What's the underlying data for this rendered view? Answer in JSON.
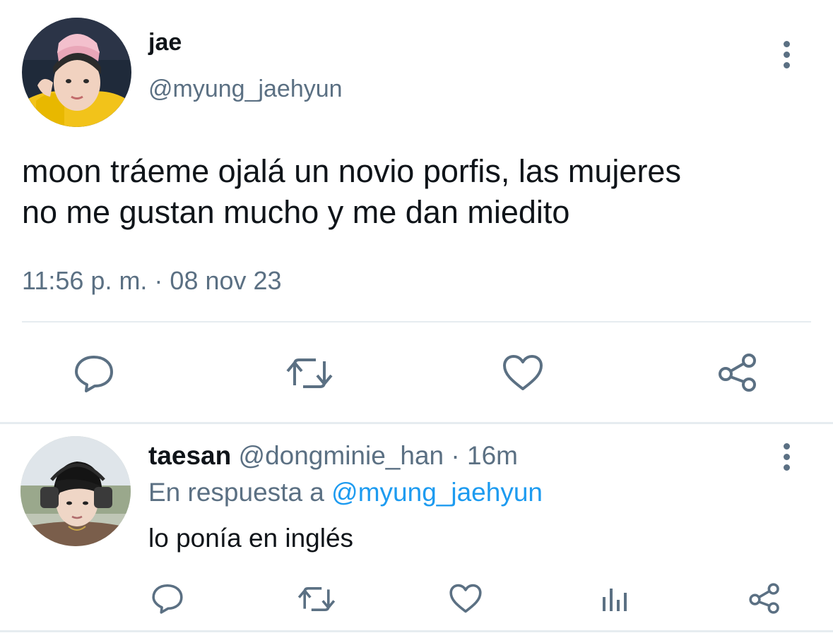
{
  "main_tweet": {
    "author_name": "jae",
    "handle": "@myung_jaehyun",
    "text_line1": "moon tráeme ojalá un novio porfis, las mujeres",
    "text_line2": "no me gustan mucho y me dan miedito",
    "timestamp": "11:56 p. m. · 08 nov 23",
    "actions": [
      "reply-icon",
      "retweet-icon",
      "like-icon",
      "share-icon"
    ],
    "more_icon": "kebab-icon"
  },
  "reply_tweet": {
    "author_name": "taesan",
    "handle": "@dongminie_han",
    "separator": "·",
    "time_ago": "16m",
    "reply_prefix": "En respuesta a",
    "reply_to": "@myung_jaehyun",
    "text": "lo ponía en inglés",
    "actions": [
      "reply-icon",
      "retweet-icon",
      "like-icon",
      "analytics-icon",
      "share-icon"
    ],
    "more_icon": "kebab-icon"
  },
  "colors": {
    "text": "#0f1419",
    "muted": "#5b7083",
    "link": "#1d9bf0",
    "divider": "#e6ecf0"
  }
}
